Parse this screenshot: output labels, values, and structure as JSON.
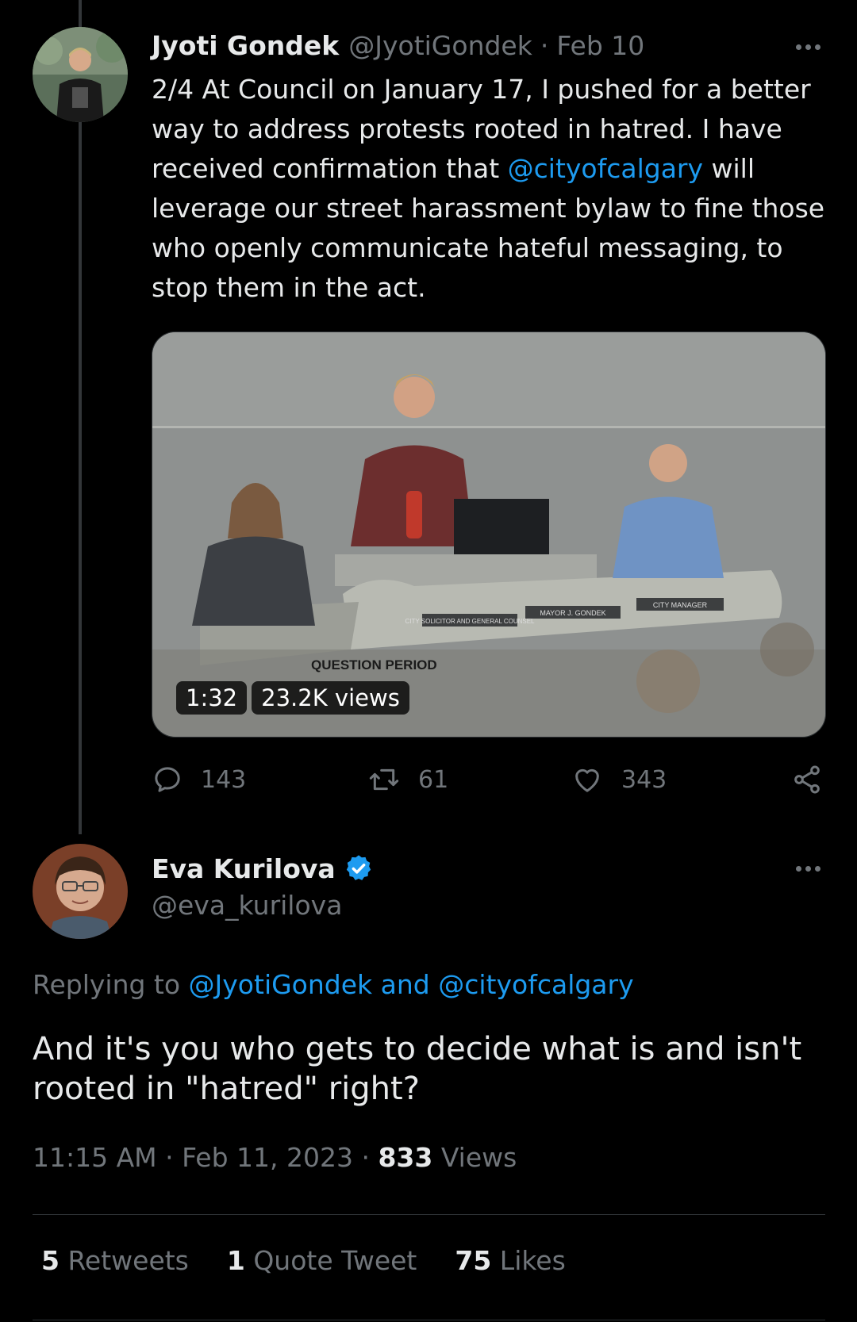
{
  "tweet1": {
    "display_name": "Jyoti Gondek",
    "handle": "@JyotiGondek",
    "separator": "·",
    "date": "Feb 10",
    "text_parts": {
      "before_mention": "2/4 At Council on January 17, I pushed for a better way to address protests rooted in hatred. I have received confirmation that ",
      "mention": "@cityofcalgary",
      "after_mention": " will leverage our street harassment bylaw to fine those who openly communicate hateful messaging, to stop them in the act."
    },
    "video": {
      "duration": "1:32",
      "views": "23.2K views",
      "overlay_text": {
        "question_period": "QUESTION PERIOD",
        "nameplate_left": "CITY SOLICITOR AND GENERAL COUNSEL",
        "nameplate_center": "MAYOR J. GONDEK",
        "nameplate_right": "CITY MANAGER"
      }
    },
    "actions": {
      "replies": "143",
      "retweets": "61",
      "likes": "343"
    }
  },
  "tweet2": {
    "display_name": "Eva Kurilova",
    "handle": "@eva_kurilova",
    "verified": true,
    "replying": {
      "prefix": "Replying to ",
      "mention1": "@JyotiGondek",
      "connector": " and ",
      "mention2": "@cityofcalgary"
    },
    "text": "And it's you who gets to decide what is and isn't rooted in \"hatred\" right?",
    "meta": {
      "time_date": "11:15 AM · Feb 11, 2023 · ",
      "views_count": "833",
      "views_label": " Views"
    },
    "stats": {
      "retweets_count": "5",
      "retweets_label": " Retweets",
      "quotes_count": "1",
      "quotes_label": " Quote Tweet",
      "likes_count": "75",
      "likes_label": " Likes"
    }
  },
  "colors": {
    "background": "#000000",
    "text_primary": "#e7e9ea",
    "text_secondary": "#71767b",
    "link": "#1d9bf0",
    "divider": "#2f3336"
  },
  "icons": [
    "more-icon",
    "reply-icon",
    "retweet-icon",
    "like-icon",
    "share-icon",
    "verified-badge-icon"
  ]
}
